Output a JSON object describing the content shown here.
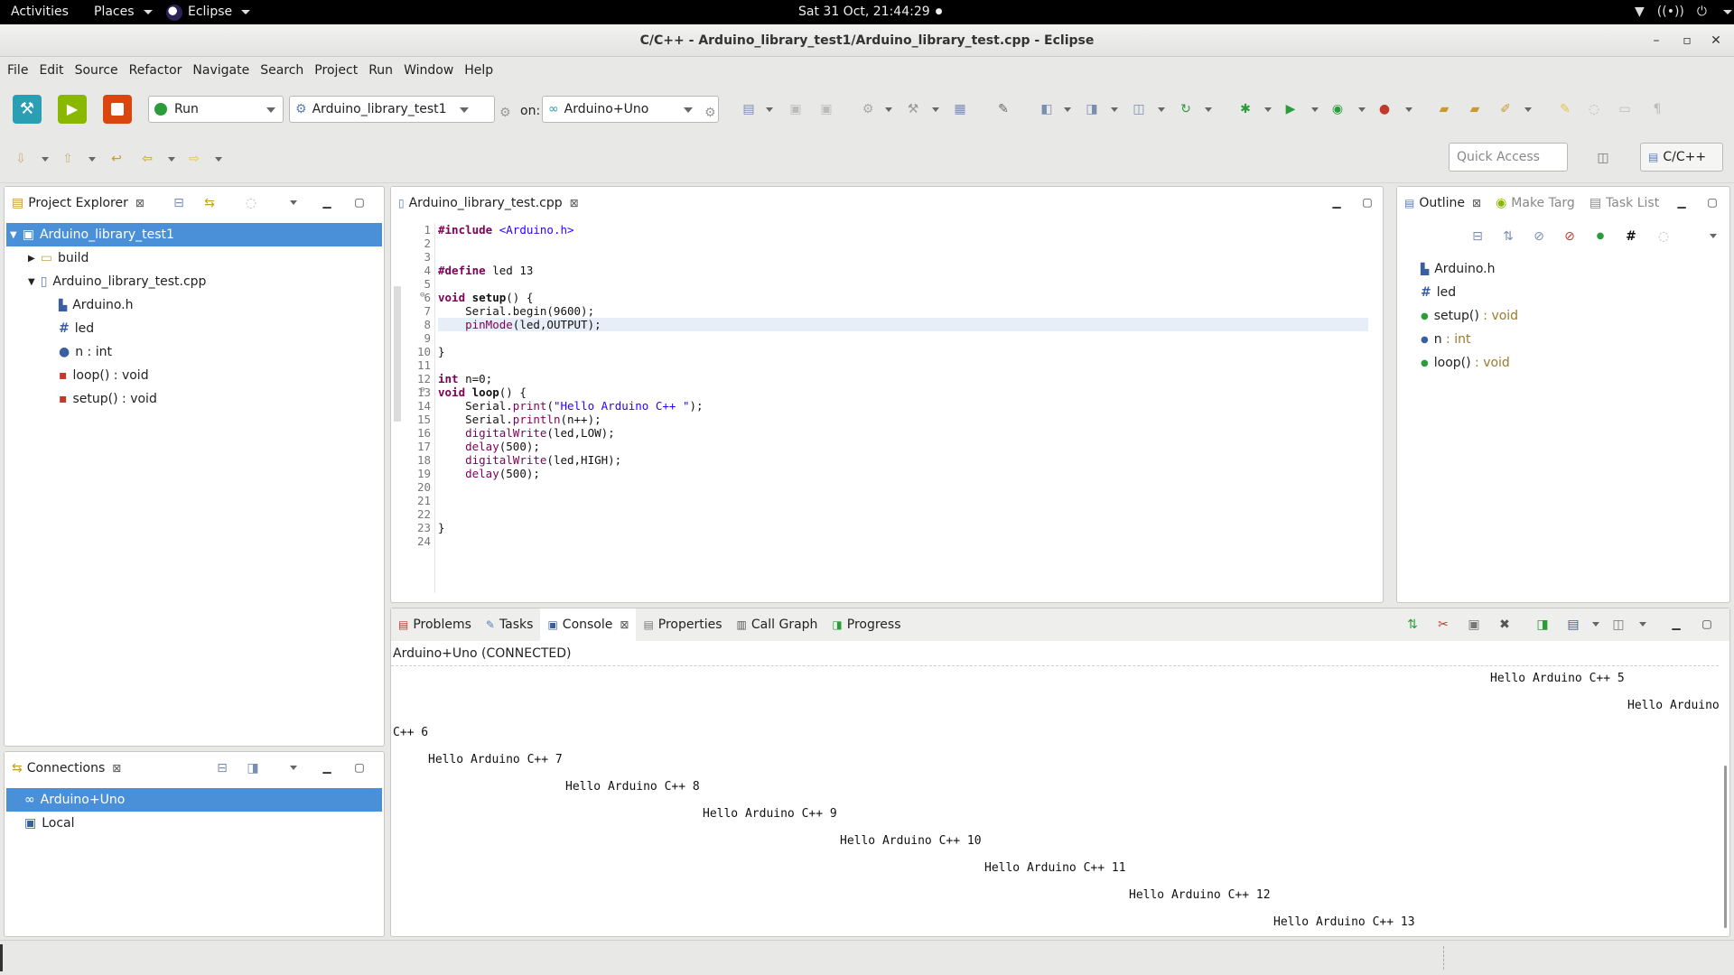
{
  "topbar": {
    "activities": "Activities",
    "places": "Places",
    "app": "Eclipse",
    "clock": "Sat 31 Oct, 21:44:29",
    "clock_dot": "●"
  },
  "window": {
    "title": "C/C++ - Arduino_library_test1/Arduino_library_test.cpp - Eclipse",
    "min": "–",
    "max": "▫",
    "close": "✕"
  },
  "menu": [
    "File",
    "Edit",
    "Source",
    "Refactor",
    "Navigate",
    "Search",
    "Project",
    "Run",
    "Window",
    "Help"
  ],
  "toolbar": {
    "launch_mode": "Run",
    "launch_config": "Arduino_library_test1",
    "on_label": "on:",
    "target": "Arduino+Uno",
    "quick_access_placeholder": "Quick Access",
    "perspective": "C/C++"
  },
  "project_explorer": {
    "title": "Project Explorer",
    "items": [
      {
        "label": "Arduino_library_test1",
        "icon": "project-icon"
      },
      {
        "label": "build",
        "icon": "folder-icon"
      },
      {
        "label": "Arduino_library_test.cpp",
        "icon": "cpp-file-icon"
      },
      {
        "label": "Arduino.h",
        "icon": "include-icon"
      },
      {
        "label": "led",
        "icon": "macro-icon"
      },
      {
        "label": "n : int",
        "icon": "variable-icon"
      },
      {
        "label": "loop() : void",
        "icon": "function-icon"
      },
      {
        "label": "setup() : void",
        "icon": "function-icon"
      }
    ]
  },
  "connections": {
    "title": "Connections",
    "items": [
      {
        "label": "Arduino+Uno",
        "icon": "serial-connection-icon"
      },
      {
        "label": "Local",
        "icon": "local-connection-icon"
      }
    ]
  },
  "editor": {
    "tab": "Arduino_library_test.cpp",
    "line_numbers": [
      "1",
      "2",
      "3",
      "4",
      "5",
      "6",
      "7",
      "8",
      "9",
      "10",
      "11",
      "12",
      "13",
      "14",
      "15",
      "16",
      "17",
      "18",
      "19",
      "20",
      "21",
      "22",
      "23",
      "24"
    ],
    "fold_marks": {
      "6": "⊖",
      "13": "⊖"
    }
  },
  "outline": {
    "tabs": [
      "Outline",
      "Make Targ",
      "Task List"
    ],
    "items": [
      {
        "name": "Arduino.h",
        "type": "",
        "icon": "include-icon"
      },
      {
        "name": "led",
        "type": "",
        "icon": "macro-icon"
      },
      {
        "name": "setup()",
        "type": " : void",
        "icon": "function-icon"
      },
      {
        "name": "n",
        "type": " : int",
        "icon": "variable-icon"
      },
      {
        "name": "loop()",
        "type": " : void",
        "icon": "function-icon"
      }
    ]
  },
  "bottom": {
    "tabs": [
      "Problems",
      "Tasks",
      "Console",
      "Properties",
      "Call Graph",
      "Progress"
    ],
    "console_header": "Arduino+Uno (CONNECTED)",
    "output": [
      "Hello Arduino C++ 5",
      "Hello Arduino",
      "C++ 6",
      "Hello Arduino C++ 7",
      "Hello Arduino C++ 8",
      "Hello Arduino C++ 9",
      "Hello Arduino C++ 10",
      "Hello Arduino C++ 11",
      "Hello Arduino C++ 12",
      "Hello Arduino C++ 13"
    ]
  },
  "colors": {
    "selection": "#4a90d9",
    "build_button": "#2a9fb3",
    "run_button": "#8ab800",
    "stop_button": "#d9460f"
  }
}
